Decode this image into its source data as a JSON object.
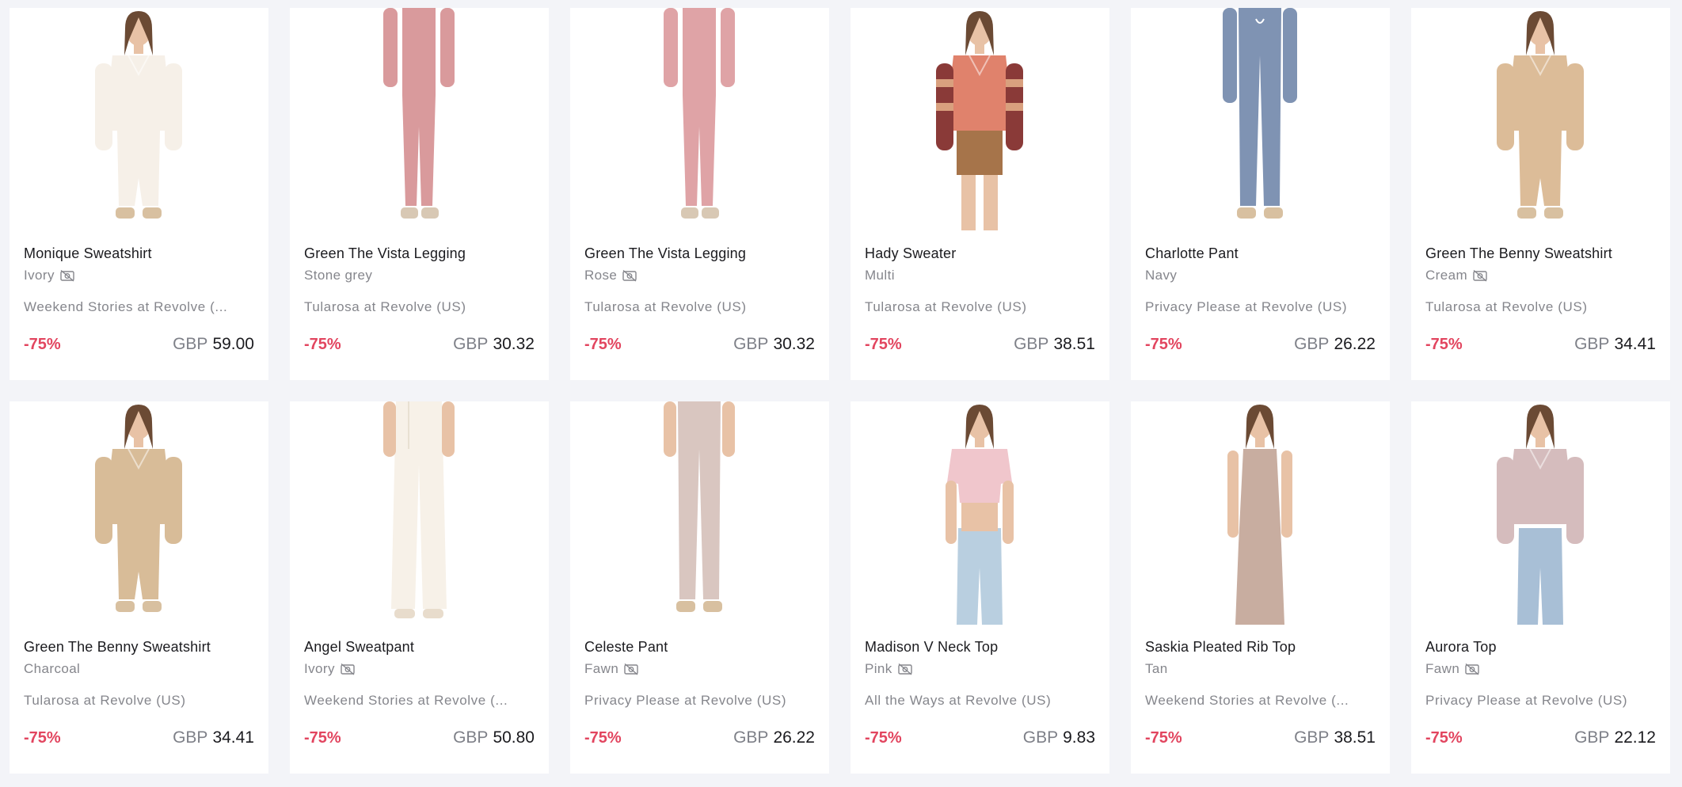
{
  "products": [
    {
      "name": "Monique Sweatshirt",
      "color": "Ivory",
      "no_photo": true,
      "seller": "Weekend Stories at Revolve (...",
      "discount": "-75%",
      "currency": "GBP",
      "price": "59.00",
      "garment": "sweatshirt",
      "top_color": "#f6f0e8",
      "bottom_color": "#f6f0e8",
      "bottom": "pants"
    },
    {
      "name": "Green The Vista Legging",
      "color": "Stone grey",
      "no_photo": false,
      "seller": "Tularosa at Revolve (US)",
      "discount": "-75%",
      "currency": "GBP",
      "price": "30.32",
      "garment": "legging",
      "top_color": "#d99a9c",
      "bottom_color": "#d99a9c",
      "bottom": "legging"
    },
    {
      "name": "Green The Vista Legging",
      "color": "Rose",
      "no_photo": true,
      "seller": "Tularosa at Revolve (US)",
      "discount": "-75%",
      "currency": "GBP",
      "price": "30.32",
      "garment": "legging",
      "top_color": "#dfa3a6",
      "bottom_color": "#dfa3a6",
      "bottom": "legging"
    },
    {
      "name": "Hady Sweater",
      "color": "Multi",
      "no_photo": false,
      "seller": "Tularosa at Revolve (US)",
      "discount": "-75%",
      "currency": "GBP",
      "price": "38.51",
      "garment": "sweater",
      "top_color": "#e0826c",
      "bottom_color": "#a6744a",
      "bottom": "shorts"
    },
    {
      "name": "Charlotte Pant",
      "color": "Navy",
      "no_photo": false,
      "seller": "Privacy Please at Revolve (US)",
      "discount": "-75%",
      "currency": "GBP",
      "price": "26.22",
      "garment": "pant",
      "top_color": "#7f93b3",
      "bottom_color": "#7f93b3",
      "bottom": "pants"
    },
    {
      "name": "Green The Benny Sweatshirt",
      "color": "Cream",
      "no_photo": true,
      "seller": "Tularosa at Revolve (US)",
      "discount": "-75%",
      "currency": "GBP",
      "price": "34.41",
      "garment": "sweatshirt",
      "top_color": "#dcbc98",
      "bottom_color": "#dcbc98",
      "bottom": "pants"
    },
    {
      "name": "Green The Benny Sweatshirt",
      "color": "Charcoal",
      "no_photo": false,
      "seller": "Tularosa at Revolve (US)",
      "discount": "-75%",
      "currency": "GBP",
      "price": "34.41",
      "garment": "sweatshirt",
      "top_color": "#d8bc98",
      "bottom_color": "#d8bc98",
      "bottom": "pants"
    },
    {
      "name": "Angel Sweatpant",
      "color": "Ivory",
      "no_photo": true,
      "seller": "Weekend Stories at Revolve (...",
      "discount": "-75%",
      "currency": "GBP",
      "price": "50.80",
      "garment": "pant",
      "top_color": "#f7f1e8",
      "bottom_color": "#f7f1e8",
      "bottom": "flare"
    },
    {
      "name": "Celeste Pant",
      "color": "Fawn",
      "no_photo": true,
      "seller": "Privacy Please at Revolve (US)",
      "discount": "-75%",
      "currency": "GBP",
      "price": "26.22",
      "garment": "pant",
      "top_color": "#d9c6c0",
      "bottom_color": "#d9c6c0",
      "bottom": "pants"
    },
    {
      "name": "Madison V Neck Top",
      "color": "Pink",
      "no_photo": true,
      "seller": "All the Ways at Revolve (US)",
      "discount": "-75%",
      "currency": "GBP",
      "price": "9.83",
      "garment": "crop",
      "top_color": "#f0c6cc",
      "bottom_color": "#b9cfe0",
      "bottom": "jeans"
    },
    {
      "name": "Saskia Pleated Rib Top",
      "color": "Tan",
      "no_photo": false,
      "seller": "Weekend Stories at Revolve (...",
      "discount": "-75%",
      "currency": "GBP",
      "price": "38.51",
      "garment": "tank",
      "top_color": "#c8ada0",
      "bottom_color": "#c8ada0",
      "bottom": "skirt"
    },
    {
      "name": "Aurora Top",
      "color": "Fawn",
      "no_photo": true,
      "seller": "Privacy Please at Revolve (US)",
      "discount": "-75%",
      "currency": "GBP",
      "price": "22.12",
      "garment": "top",
      "top_color": "#d5bcbd",
      "bottom_color": "#a8bfd6",
      "bottom": "jeans"
    }
  ]
}
